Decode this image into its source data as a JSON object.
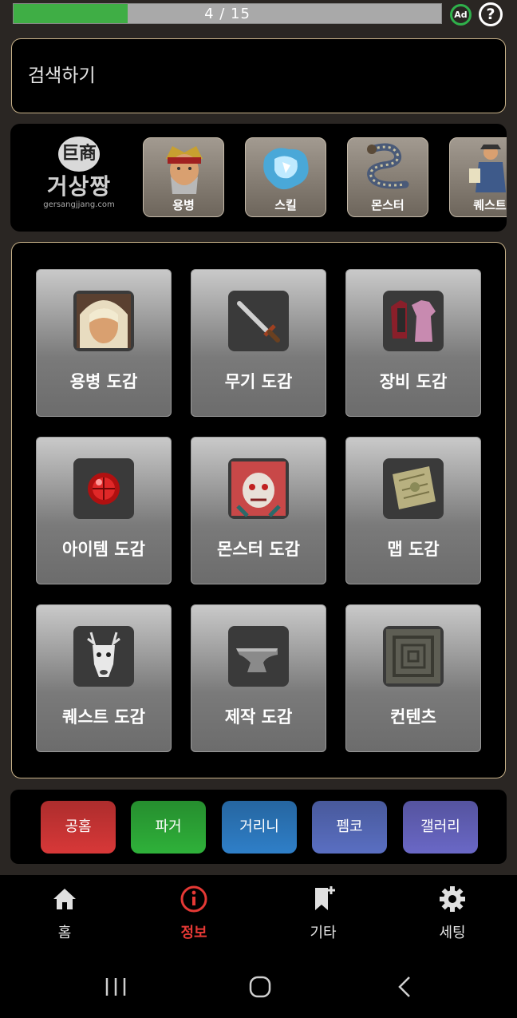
{
  "progress": {
    "text": "4 / 15",
    "current": 4,
    "total": 15
  },
  "top_icons": {
    "ad": "Ad",
    "help": "?"
  },
  "search": {
    "placeholder": "검색하기"
  },
  "logo": {
    "seal": "巨商",
    "name": "거상짱",
    "url": "gersangjjang.com"
  },
  "categories": [
    {
      "label": "용병",
      "icon": "mercenary-portrait-icon"
    },
    {
      "label": "스킬",
      "icon": "skill-crystal-icon"
    },
    {
      "label": "몬스터",
      "icon": "serpent-monster-icon"
    },
    {
      "label": "퀘스트",
      "icon": "quest-npc-icon"
    }
  ],
  "grid": [
    {
      "label": "용병 도감",
      "icon": "mercenary-face-icon"
    },
    {
      "label": "무기 도감",
      "icon": "sword-icon"
    },
    {
      "label": "장비 도감",
      "icon": "armor-icon"
    },
    {
      "label": "아이템 도감",
      "icon": "red-orb-icon"
    },
    {
      "label": "몬스터 도감",
      "icon": "monster-face-icon"
    },
    {
      "label": "맵 도감",
      "icon": "map-scroll-icon"
    },
    {
      "label": "퀘스트 도감",
      "icon": "deer-head-icon"
    },
    {
      "label": "제작 도감",
      "icon": "anvil-icon"
    },
    {
      "label": "컨텐츠",
      "icon": "stone-tile-icon"
    }
  ],
  "links": [
    {
      "label": "공홈",
      "color": "#d83838"
    },
    {
      "label": "파거",
      "color": "#2fb13a"
    },
    {
      "label": "거리니",
      "color": "#2f7fc8"
    },
    {
      "label": "펨코",
      "color": "#5a6fc2"
    },
    {
      "label": "갤러리",
      "color": "#6a68c6"
    }
  ],
  "nav": [
    {
      "label": "홈",
      "icon": "home-icon",
      "active": false
    },
    {
      "label": "정보",
      "icon": "info-icon",
      "active": true
    },
    {
      "label": "기타",
      "icon": "bookmark-plus-icon",
      "active": false
    },
    {
      "label": "세팅",
      "icon": "gear-icon",
      "active": false
    }
  ],
  "colors": {
    "accent_active": "#e53935",
    "progress_fill": "#3fae45",
    "panel_border": "#c9b38a"
  }
}
